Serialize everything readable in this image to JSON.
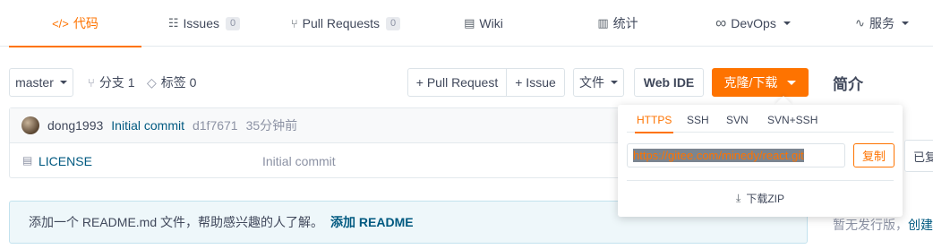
{
  "tabs": [
    {
      "icon": "</>",
      "label": "代码",
      "active": true
    },
    {
      "icon": "☷",
      "label": "Issues",
      "count": "0"
    },
    {
      "icon": "⑂",
      "label": "Pull Requests",
      "count": "0"
    },
    {
      "icon": "▤",
      "label": "Wiki"
    },
    {
      "icon": "▥",
      "label": "统计"
    },
    {
      "icon": "∞",
      "label": "DevOps"
    },
    {
      "icon": "∿",
      "label": "服务"
    }
  ],
  "toolbar": {
    "branch": "master",
    "branches_label": "分支 1",
    "tags_label": "标签 0",
    "pull_request_label": "+ Pull Request",
    "issue_label": "+ Issue",
    "file_label": "文件",
    "web_ide_label": "Web IDE",
    "clone_label": "克隆/下载"
  },
  "sidebar": {
    "intro_title": "简介",
    "release_text": "暂无发行版，",
    "release_link": "创建"
  },
  "commit": {
    "user": "dong1993",
    "message": "Initial commit",
    "hash": "d1f7671",
    "time": "35分钟前"
  },
  "files": [
    {
      "name": "LICENSE",
      "commit": "Initial commit"
    }
  ],
  "readme_notice": {
    "text": "添加一个 README.md 文件，帮助感兴趣的人了解。",
    "link": "添加 README"
  },
  "clone_popup": {
    "tabs": [
      "HTTPS",
      "SSH",
      "SVN",
      "SVN+SSH"
    ],
    "active_tab": "HTTPS",
    "url": "https://gitee.com/minedy/react.git",
    "copy_label": "复制",
    "copied_tooltip": "已复制",
    "zip_label": "下载ZIP"
  },
  "colors": {
    "accent": "#fe7300",
    "link": "#005980",
    "text": "#40485b",
    "muted": "#8c92a4"
  }
}
